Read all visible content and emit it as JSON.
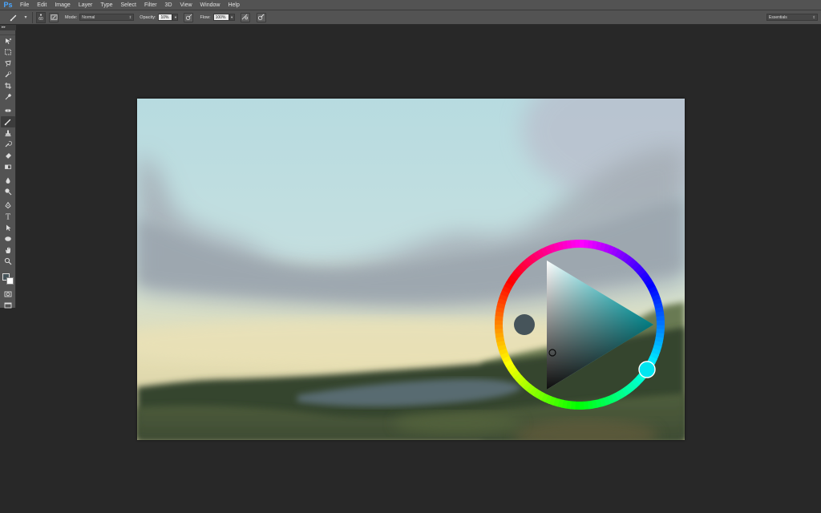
{
  "app": {
    "logo": "Ps",
    "menu": [
      "File",
      "Edit",
      "Image",
      "Layer",
      "Type",
      "Select",
      "Filter",
      "3D",
      "View",
      "Window",
      "Help"
    ]
  },
  "options_bar": {
    "brush_size": "60",
    "mode_label": "Mode:",
    "mode_value": "Normal",
    "opacity_label": "Opacity:",
    "opacity_value": "10%",
    "flow_label": "Flow:",
    "flow_value": "100%",
    "workspace_value": "Essentials"
  },
  "toolbar": {
    "collapse_label": "▸▸",
    "tools": [
      "move-tool",
      "marquee-tool",
      "lasso-tool",
      "quick-selection-tool",
      "crop-tool",
      "eyedropper-tool",
      "healing-brush-tool",
      "brush-tool",
      "clone-stamp-tool",
      "history-brush-tool",
      "eraser-tool",
      "gradient-tool",
      "blur-tool",
      "dodge-tool",
      "pen-tool",
      "type-tool",
      "path-selection-tool",
      "ellipse-tool",
      "hand-tool",
      "zoom-tool"
    ],
    "active_tool": "brush-tool",
    "foreground_color": "#46545a",
    "background_color": "#ffffff"
  },
  "color_picker": {
    "hue_color": "#00e5f0",
    "current_color": "#46545a"
  }
}
